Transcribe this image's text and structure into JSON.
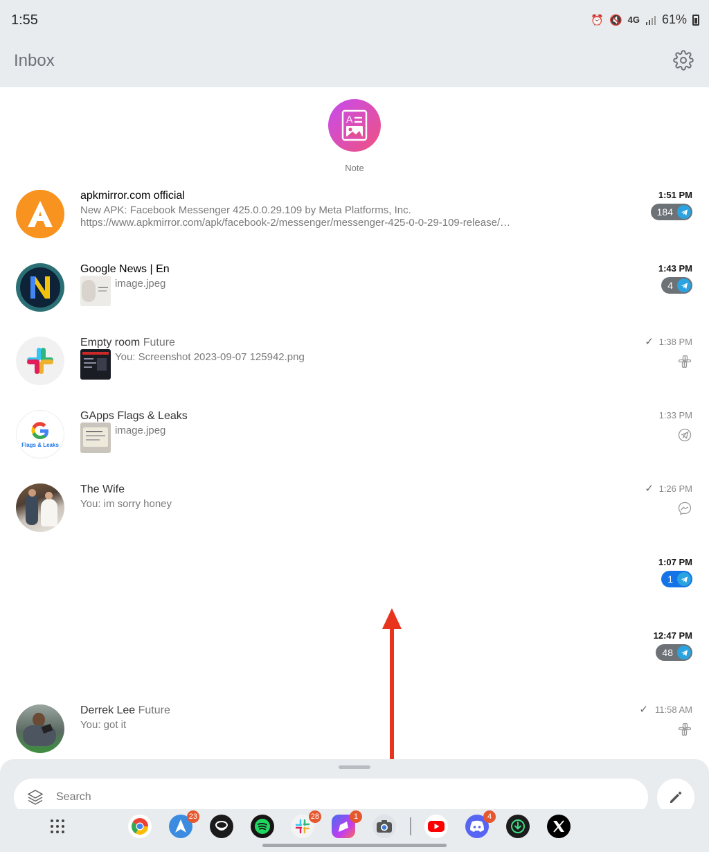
{
  "status_bar": {
    "time": "1:55",
    "network": "4G",
    "battery": "61%"
  },
  "header": {
    "title": "Inbox",
    "settings_icon": "gear-icon"
  },
  "note": {
    "label": "Note",
    "icon": "note-image-icon"
  },
  "conversations": [
    {
      "name": "apkmirror.com official",
      "tag": "",
      "preview_line1": "New APK: Facebook Messenger 425.0.0.29.109 by Meta Platforms, Inc.",
      "preview_line2": "https://www.apkmirror.com/apk/facebook-2/messenger/messenger-425-0-0-29-109-release/…",
      "time": "1:51 PM",
      "unread": "184",
      "service": "telegram"
    },
    {
      "name": "Google News | En",
      "tag": "",
      "preview_line1": "image.jpeg",
      "time": "1:43 PM",
      "unread": "4",
      "service": "telegram"
    },
    {
      "name": "Empty room",
      "tag": "Future",
      "preview_line1": "You: Screenshot 2023-09-07 125942.png",
      "time": "1:38 PM",
      "sent_check": "✓",
      "service": "slack"
    },
    {
      "name": "GApps Flags & Leaks",
      "tag": "",
      "avatar_text": "Flags & Leaks",
      "preview_line1": "image.jpeg",
      "time": "1:33 PM",
      "service": "telegram"
    },
    {
      "name": "The Wife",
      "tag": "",
      "preview_line1": "You: im sorry honey",
      "time": "1:26 PM",
      "sent_check": "✓",
      "service": "messenger"
    },
    {
      "time": "1:07 PM",
      "unread": "1",
      "service": "telegram"
    },
    {
      "time": "12:47 PM",
      "unread": "48",
      "service": "telegram"
    },
    {
      "name": "Derrek Lee",
      "tag": "Future",
      "preview_line1": "You: got it",
      "time": "11:58 AM",
      "sent_check": "✓",
      "service": "slack"
    }
  ],
  "search": {
    "placeholder": "Search"
  },
  "dock": {
    "apps": [
      {
        "name": "app-drawer"
      },
      {
        "name": "chrome"
      },
      {
        "name": "spark-mail",
        "badge": "23"
      },
      {
        "name": "beeper"
      },
      {
        "name": "spotify"
      },
      {
        "name": "slack",
        "badge": "28"
      },
      {
        "name": "messenger-app",
        "badge": "1"
      },
      {
        "name": "camera"
      },
      {
        "name": "youtube"
      },
      {
        "name": "discord",
        "badge": "4"
      },
      {
        "name": "download-manager"
      },
      {
        "name": "x"
      }
    ]
  },
  "colors": {
    "header_bg": "#e9ecef",
    "badge_gray": "#6d7277",
    "badge_blue": "#1473e6",
    "telegram": "#2aa3e0",
    "annotation_red": "#e8341c"
  }
}
